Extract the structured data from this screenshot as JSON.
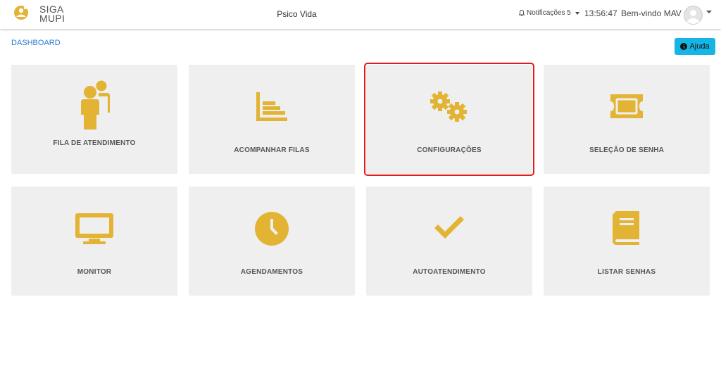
{
  "header": {
    "logo_top": "SIGA",
    "logo_bottom": "MUPI",
    "app_title": "Psico Vida",
    "notifications_label": "Notificações 5",
    "clock": "13:56:47",
    "welcome": "Bem-vindo MAV"
  },
  "breadcrumb": "DASHBOARD",
  "help_label": "Ajuda",
  "colors": {
    "accent": "#e3b334",
    "tile_bg": "#efefef",
    "selected_border": "#e01b1b",
    "help_bg": "#17b5e6",
    "link": "#2a7ad1"
  },
  "tiles": [
    {
      "label": "FILA DE ATENDIMENTO",
      "icon": "person-icon"
    },
    {
      "label": "ACOMPANHAR FILAS",
      "icon": "bar-list-icon"
    },
    {
      "label": "CONFIGURAÇÕES",
      "icon": "gears-icon",
      "selected": true
    },
    {
      "label": "SELEÇÃO DE SENHA",
      "icon": "ticket-icon"
    },
    {
      "label": "MONITOR",
      "icon": "monitor-icon"
    },
    {
      "label": "AGENDAMENTOS",
      "icon": "clock-icon"
    },
    {
      "label": "AUTOATENDIMENTO",
      "icon": "check-icon"
    },
    {
      "label": "LISTAR SENHAS",
      "icon": "book-icon"
    }
  ]
}
